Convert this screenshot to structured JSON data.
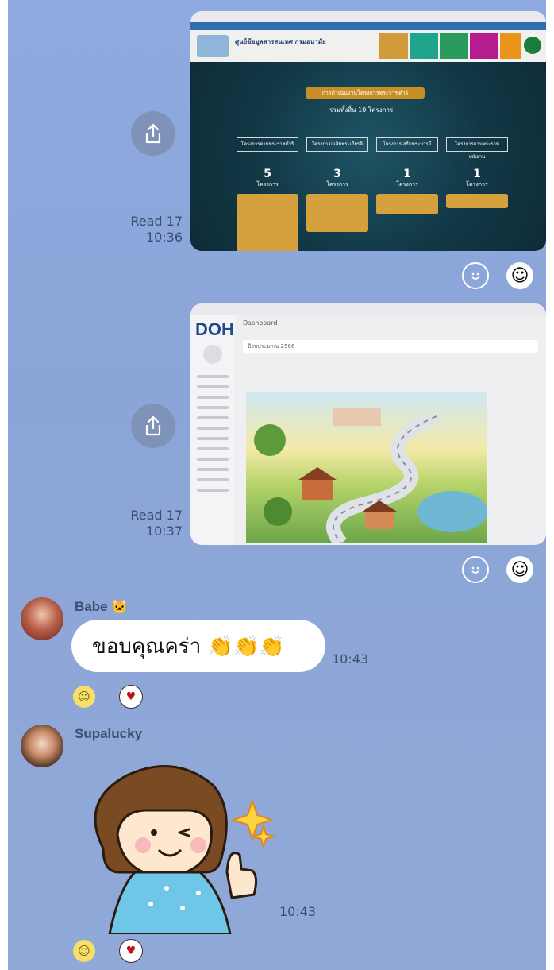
{
  "messages": [
    {
      "read_label": "Read 17",
      "time": "10:36"
    },
    {
      "read_label": "Read 17",
      "time": "10:37"
    }
  ],
  "babe": {
    "name": "Babe 🐱",
    "text": "ขอบคุณคร่า 👏👏👏",
    "time": "10:43"
  },
  "supalucky": {
    "name": "Supalucky",
    "time": "10:43"
  },
  "shot1": {
    "title": "ศูนย์ข้อมูลสารสนเทศ กรมอนามัย",
    "banner": "การดำเนินงานโครงการพระราชดำริ",
    "total": "รวมทั้งสิ้น 10 โครงการ",
    "columns": [
      {
        "label": "โครงการตามพระราชดำริ",
        "count": "5",
        "unit": "โครงการ"
      },
      {
        "label": "โครงการเฉลิมพระเกียรติ",
        "count": "3",
        "unit": "โครงการ"
      },
      {
        "label": "โครงการเสริมพระบารมี",
        "count": "1",
        "unit": "โครงการ"
      },
      {
        "label": "โครงการตามพระราชปณิธาน",
        "count": "1",
        "unit": "โครงการ"
      }
    ]
  },
  "shot2": {
    "logo": "DOH",
    "page_title": "Dashboard",
    "year": "ปีงบประมาณ 2566"
  },
  "colors": {
    "chat_bg": "#8ea7d6",
    "bubble": "#ffffff",
    "share_button": "#7f93b9"
  }
}
